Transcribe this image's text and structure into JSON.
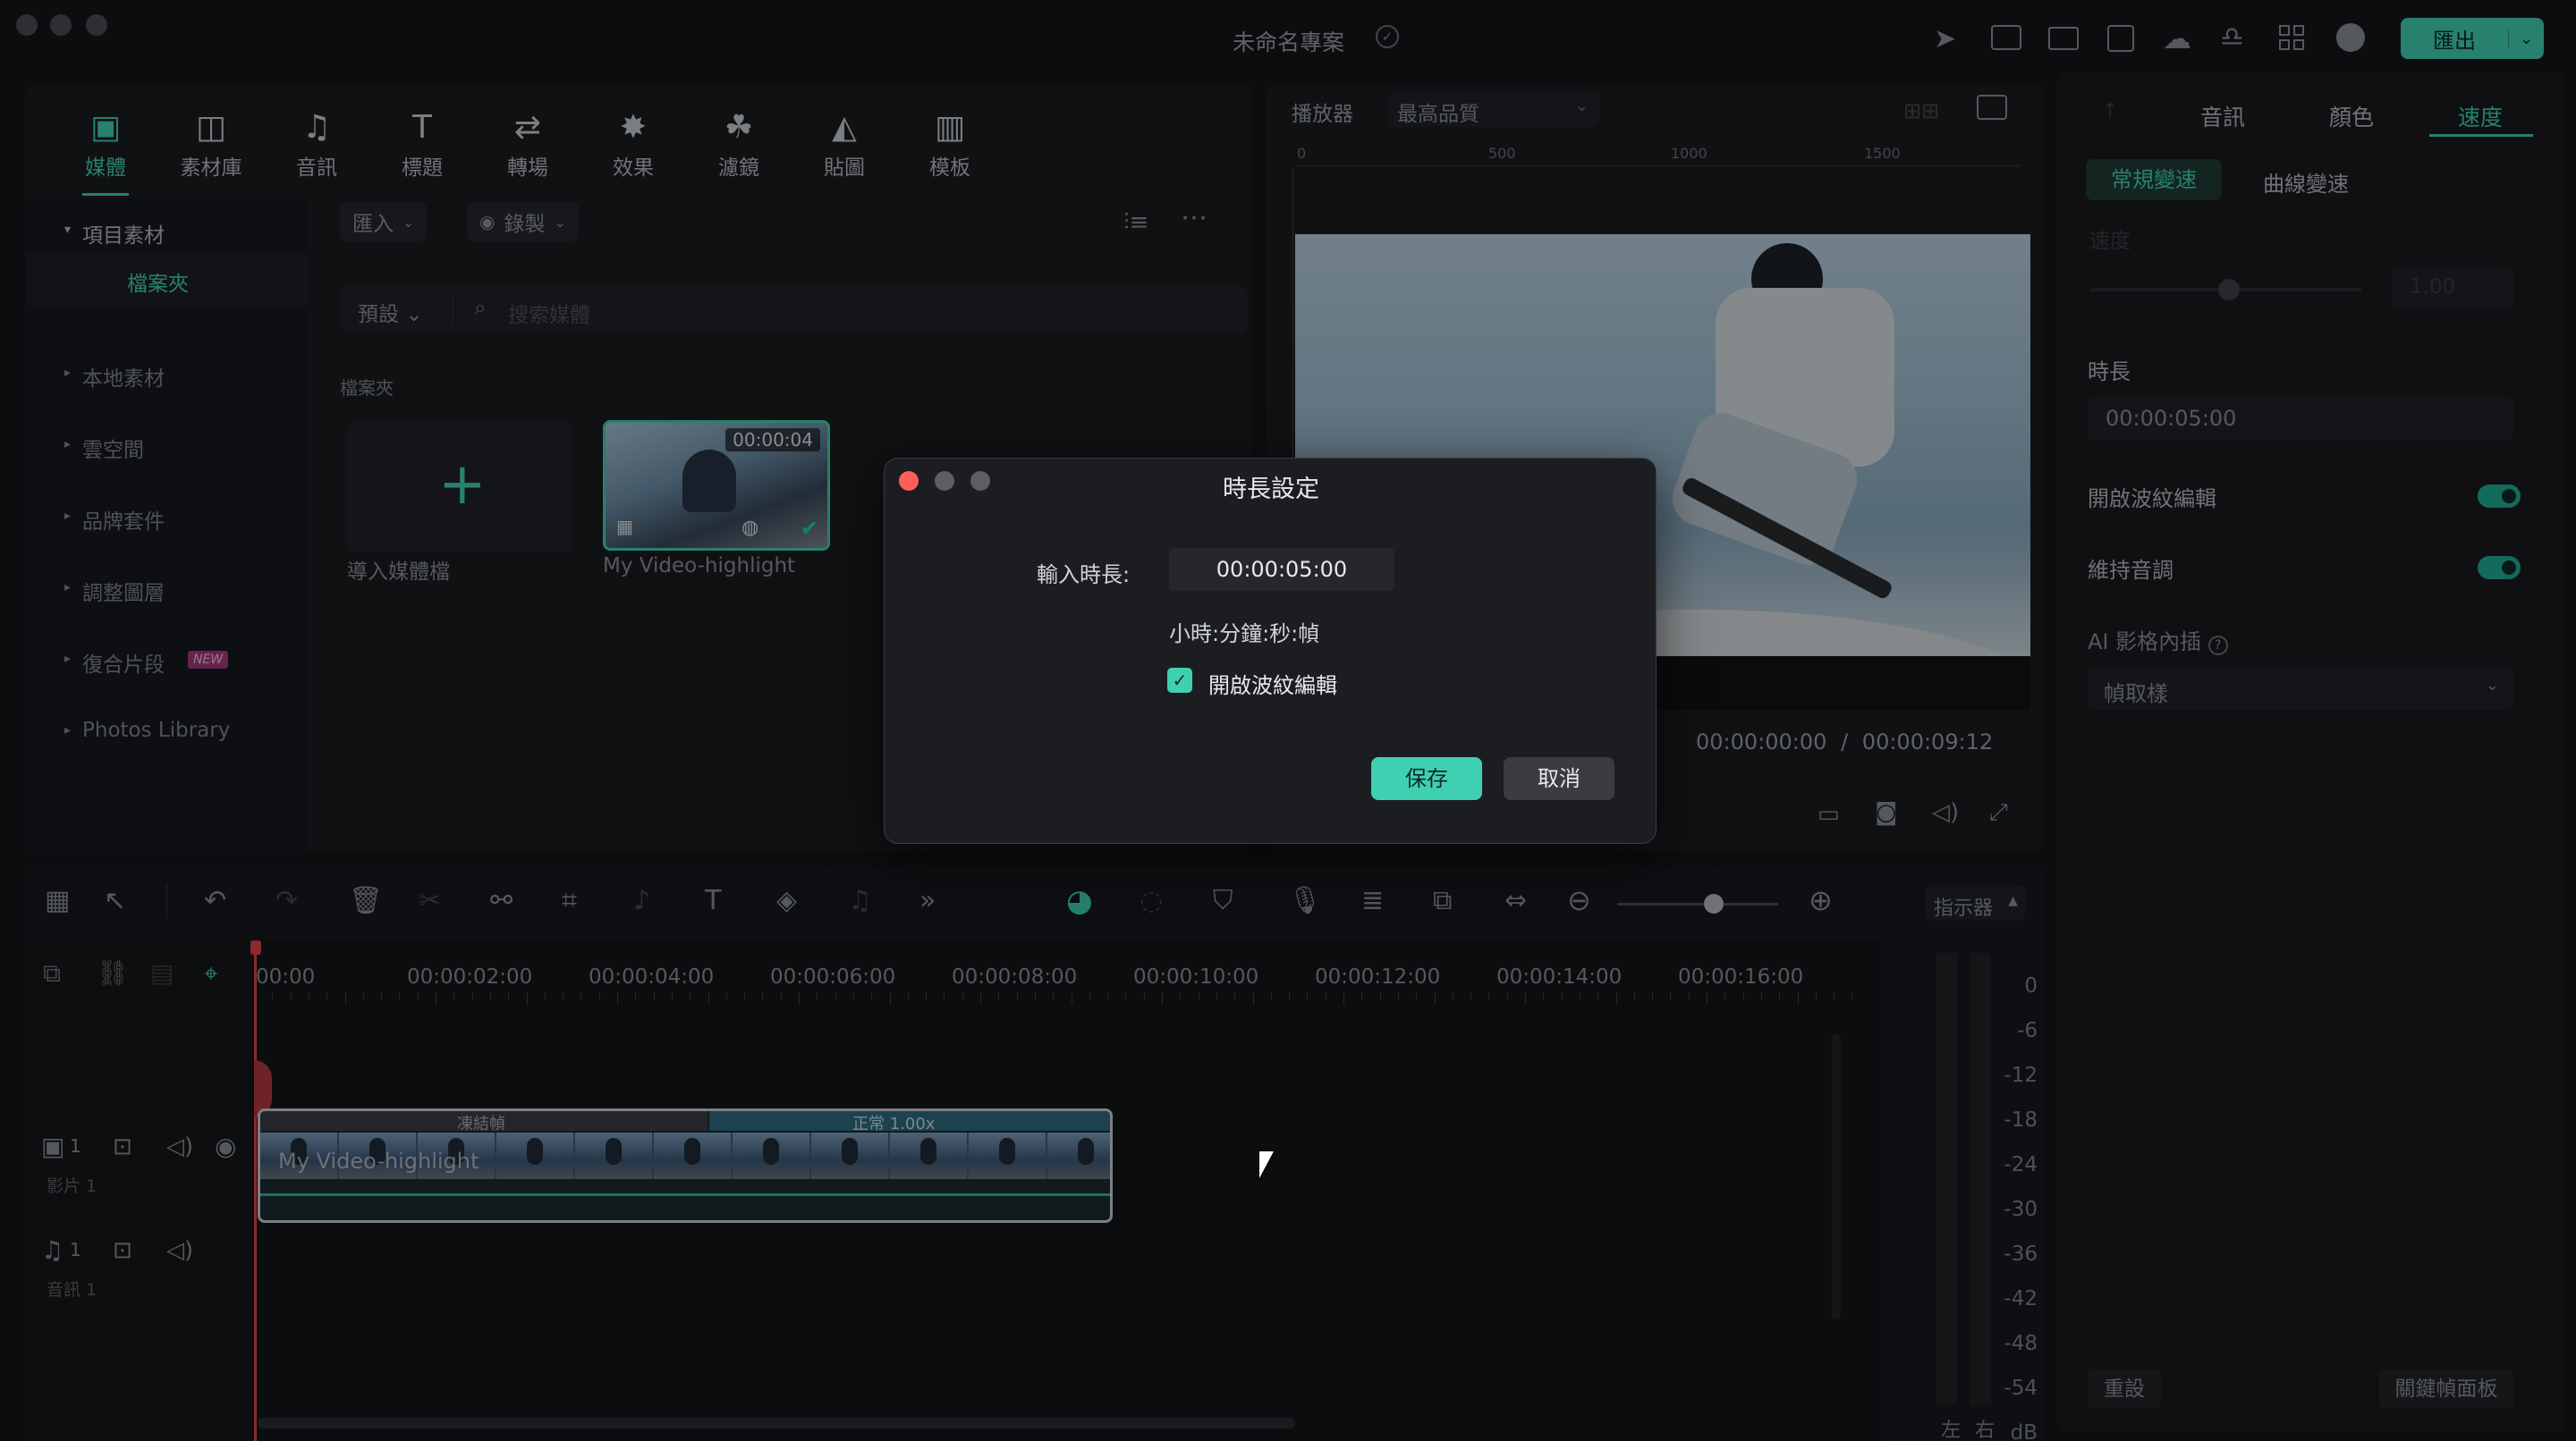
{
  "window": {
    "title": "未命名專案",
    "export_label": "匯出"
  },
  "top_tabs": [
    {
      "label": "媒體",
      "icon": "media-icon",
      "glyph": "▣"
    },
    {
      "label": "素材庫",
      "icon": "stock-icon",
      "glyph": "◫"
    },
    {
      "label": "音訊",
      "icon": "music-note-icon",
      "glyph": "♫"
    },
    {
      "label": "標題",
      "icon": "title-text-icon",
      "glyph": "T"
    },
    {
      "label": "轉場",
      "icon": "transition-icon",
      "glyph": "⇄"
    },
    {
      "label": "效果",
      "icon": "effects-sparkle-icon",
      "glyph": "✸"
    },
    {
      "label": "濾鏡",
      "icon": "filter-icon",
      "glyph": "☘"
    },
    {
      "label": "貼圖",
      "icon": "sticker-icon",
      "glyph": "◭"
    },
    {
      "label": "模板",
      "icon": "template-icon",
      "glyph": "▥"
    }
  ],
  "sidebar": {
    "items": [
      "項目素材",
      "檔案夾",
      "本地素材",
      "雲空間",
      "品牌套件",
      "調整圖層",
      "復合片段",
      "Photos Library"
    ],
    "new_badge": "NEW"
  },
  "media_toolbar": {
    "import": "匯入",
    "record": "錄製",
    "sort": "預設",
    "search_placeholder": "搜索媒體"
  },
  "media": {
    "folder_label": "檔案夾",
    "import_tile": "導入媒體檔",
    "clip_name": "My Video-highlight",
    "clip_duration": "00:00:04"
  },
  "player": {
    "label": "播放器",
    "quality": "最高品質",
    "ruler": [
      "0",
      "500",
      "1000",
      "1500"
    ],
    "current_time": "00:00:00:00",
    "separator": "/",
    "total_time": "00:00:09:12"
  },
  "right_panel": {
    "tabs": [
      "音訊",
      "顏色",
      "速度"
    ],
    "subtabs": [
      "常規變速",
      "曲線變速"
    ],
    "speed_label": "速度",
    "speed_value": "1.00",
    "duration_label": "時長",
    "duration_value": "00:00:05:00",
    "ripple_label": "開啟波紋編輯",
    "pitch_label": "維持音調",
    "ai_label": "AI 影格內插",
    "ai_value": "幀取樣",
    "reset": "重設",
    "keyframe": "關鍵幀面板"
  },
  "timeline": {
    "times": [
      "00:00",
      "00:00:02:00",
      "00:00:04:00",
      "00:00:06:00",
      "00:00:08:00",
      "00:00:10:00",
      "00:00:12:00",
      "00:00:14:00",
      "00:00:16:00"
    ],
    "indicator_label": "指示器",
    "meter": [
      "0",
      "-6",
      "-12",
      "-18",
      "-24",
      "-30",
      "-36",
      "-42",
      "-48",
      "-54",
      "dB"
    ],
    "meter_left": "左",
    "meter_right": "右",
    "video_track": "影片 1",
    "audio_track": "音訊 1",
    "track_num": "1",
    "freeze_label": "凍結幀",
    "speed_tag": "正常 1.00x",
    "clip_title": "My Video-highlight",
    "zoom_level": 0.6
  },
  "dialog": {
    "title": "時長設定",
    "input_label": "輸入時長:",
    "input_value": "00:00:05:00",
    "format_hint": "小時:分鐘:秒:幀",
    "ripple_label": "開啟波紋編輯",
    "save": "保存",
    "cancel": "取消"
  },
  "colors": {
    "accent": "#3fd0b2",
    "background": "#141518",
    "panel": "#1b1c20",
    "playhead": "#e0434c"
  }
}
